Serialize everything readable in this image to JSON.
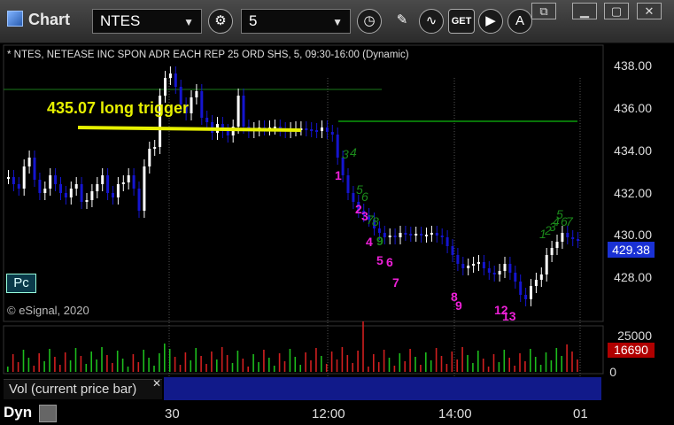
{
  "toolbar": {
    "title": "Chart",
    "symbol": "NTES",
    "interval": "5",
    "icons": [
      "settings-gear-icon",
      "clock-icon",
      "pencil-icon",
      "indicator-icon",
      "get-icon",
      "play-icon",
      "alert-icon"
    ]
  },
  "window_buttons": [
    "restore-icon",
    "minimize-icon",
    "maximize-icon",
    "close-icon"
  ],
  "chart": {
    "header": "* NTES, NETEASE INC SPON ADR EACH REP 25 ORD SHS, 5, 09:30-16:00 (Dynamic)",
    "annotation": "435.07 long trigger",
    "price_badge": "429.38",
    "vol_badge": "16690",
    "pc_button": "Pc",
    "copyright": "© eSignal, 2020",
    "vol_panel_label": "Vol (current price bar)",
    "dyn_label": "Dyn",
    "price_axis": [
      "438.00",
      "436.00",
      "434.00",
      "432.00",
      "430.00",
      "428.00"
    ],
    "vol_axis": [
      "25000",
      "0"
    ],
    "time_axis": [
      "30",
      "12:00",
      "14:00",
      "01"
    ],
    "counts": [
      "1",
      "2",
      "3",
      "4",
      "5",
      "6",
      "7",
      "8",
      "9",
      "12",
      "13",
      "3",
      "4",
      "5",
      "6",
      "7",
      "8",
      "9",
      "1",
      "2",
      "3",
      "4",
      "5",
      "6",
      "7"
    ]
  },
  "colors": {
    "price_up": "#ffffff",
    "price_down": "#1515d0",
    "trigger_line": "#e6f000",
    "level_line": "#0a9a0a",
    "count_magenta": "#ee20d8",
    "count_green": "#1b8a1b",
    "vol_up": "#1dbb1d",
    "vol_down": "#d01f1f"
  }
}
